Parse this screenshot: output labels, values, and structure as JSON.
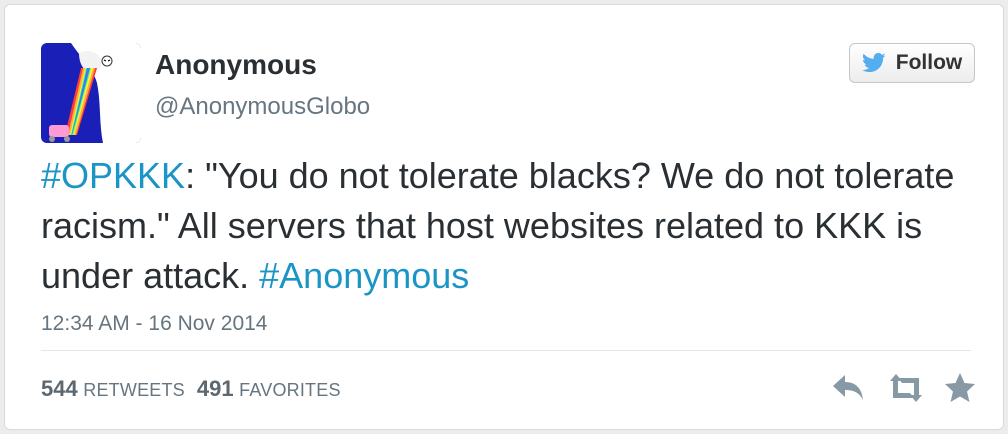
{
  "author": {
    "name": "Anonymous",
    "handle": "@AnonymousGlobo",
    "avatar_icon": "guy-fawkes-rainbow-avatar"
  },
  "follow_button": {
    "label": "Follow",
    "icon": "twitter-bird-icon",
    "bird_color": "#55acee"
  },
  "tweet": {
    "hashtag1": "#OPKKK",
    "text_part1": ": \"You do not tolerate blacks? We do not tolerate racism.\" All servers that host websites related to KKK is under attack. ",
    "hashtag2": "#Anonymous",
    "hashtag_color": "#1b95c6"
  },
  "timestamp": "12:34 AM - 16 Nov 2014",
  "stats": {
    "retweets_count": "544",
    "retweets_label": "RETWEETS",
    "favorites_count": "491",
    "favorites_label": "FAVORITES"
  },
  "actions": {
    "reply_icon": "reply-icon",
    "retweet_icon": "retweet-icon",
    "favorite_icon": "star-icon",
    "icon_color": "#8899a6"
  }
}
